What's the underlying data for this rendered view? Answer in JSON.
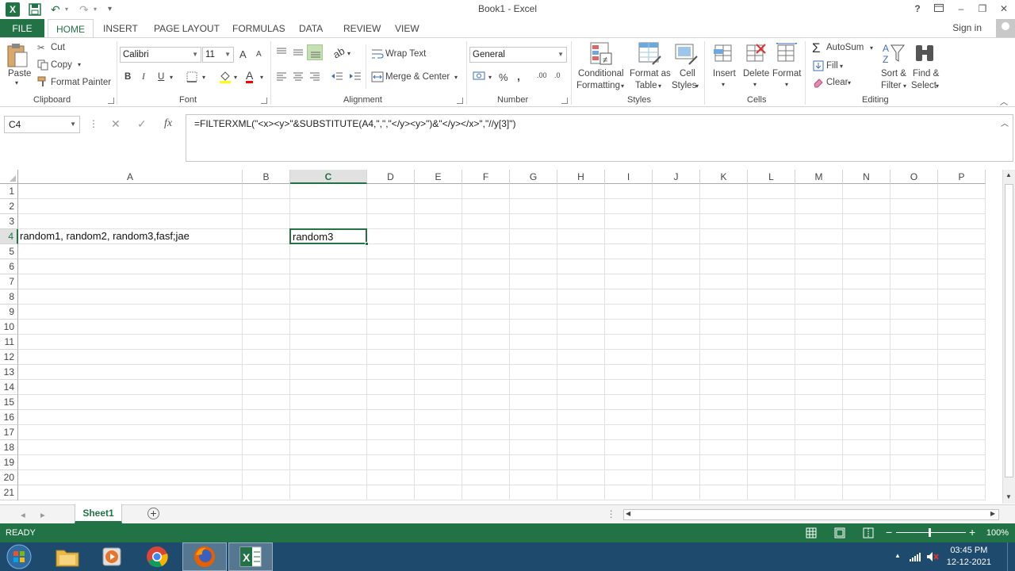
{
  "window": {
    "title": "Book1 - Excel",
    "help": "?",
    "minimize": "–",
    "restore": "❐",
    "close": "✕",
    "logo": "X",
    "qat": {
      "save_icon": "save-icon",
      "undo": "↶",
      "redo": "↷",
      "more": "▾"
    }
  },
  "ribbon_tabs": [
    "FILE",
    "HOME",
    "INSERT",
    "PAGE LAYOUT",
    "FORMULAS",
    "DATA",
    "REVIEW",
    "VIEW"
  ],
  "signin": "Sign in",
  "clipboard": {
    "paste": "Paste",
    "cut": "Cut",
    "copy": "Copy",
    "format_painter": "Format Painter",
    "label": "Clipboard"
  },
  "font": {
    "name": "Calibri",
    "size": "11",
    "grow": "A",
    "shrink": "A",
    "bold": "B",
    "italic": "I",
    "underline": "U",
    "color_letter": "A",
    "label": "Font"
  },
  "alignment": {
    "wrap_text": "Wrap Text",
    "merge_center": "Merge & Center",
    "label": "Alignment"
  },
  "number": {
    "format": "General",
    "percent": "%",
    "comma": ",",
    "inc_decimal": ".00",
    "dec_decimal": ".0",
    "label": "Number"
  },
  "styles": {
    "conditional": [
      "Conditional",
      "Formatting"
    ],
    "format_as_table": [
      "Format as",
      "Table"
    ],
    "cell_styles": [
      "Cell",
      "Styles"
    ],
    "label": "Styles"
  },
  "cells": {
    "insert": "Insert",
    "delete": "Delete",
    "format": "Format",
    "label": "Cells"
  },
  "editing": {
    "autosum": "AutoSum",
    "fill": "Fill",
    "clear": "Clear",
    "sort_filter": [
      "Sort &",
      "Filter"
    ],
    "find_select": [
      "Find &",
      "Select"
    ],
    "label": "Editing"
  },
  "formula_bar": {
    "name_box": "C4",
    "cancel": "✕",
    "enter": "✓",
    "fx": "fx",
    "formula": "=FILTERXML(\"<x><y>\"&SUBSTITUTE(A4,\",\",\"</y><y>\")&\"</y></x>\",\"//y[3]\")"
  },
  "grid": {
    "columns": [
      "A",
      "B",
      "C",
      "D",
      "E",
      "F",
      "G",
      "H",
      "I",
      "J",
      "K",
      "L",
      "M",
      "N",
      "O",
      "P"
    ],
    "rows": [
      "1",
      "2",
      "3",
      "4",
      "5",
      "6",
      "7",
      "8",
      "9",
      "10",
      "11",
      "12",
      "13",
      "14",
      "15",
      "16",
      "17",
      "18",
      "19",
      "20",
      "21"
    ],
    "selected_col": "C",
    "selected_row": "4",
    "A4": "random1, random2, random3,fasf;jae",
    "C4": "random3"
  },
  "sheets": [
    "Sheet1"
  ],
  "add_sheet": "+",
  "status": {
    "ready": "READY",
    "zoom": "100%",
    "zoom_minus": "−",
    "zoom_plus": "+"
  },
  "taskbar": {
    "time": "03:45 PM",
    "date": "12-12-2021"
  },
  "colors": {
    "accent": "#217346",
    "taskbar": "#1e4a6e"
  }
}
